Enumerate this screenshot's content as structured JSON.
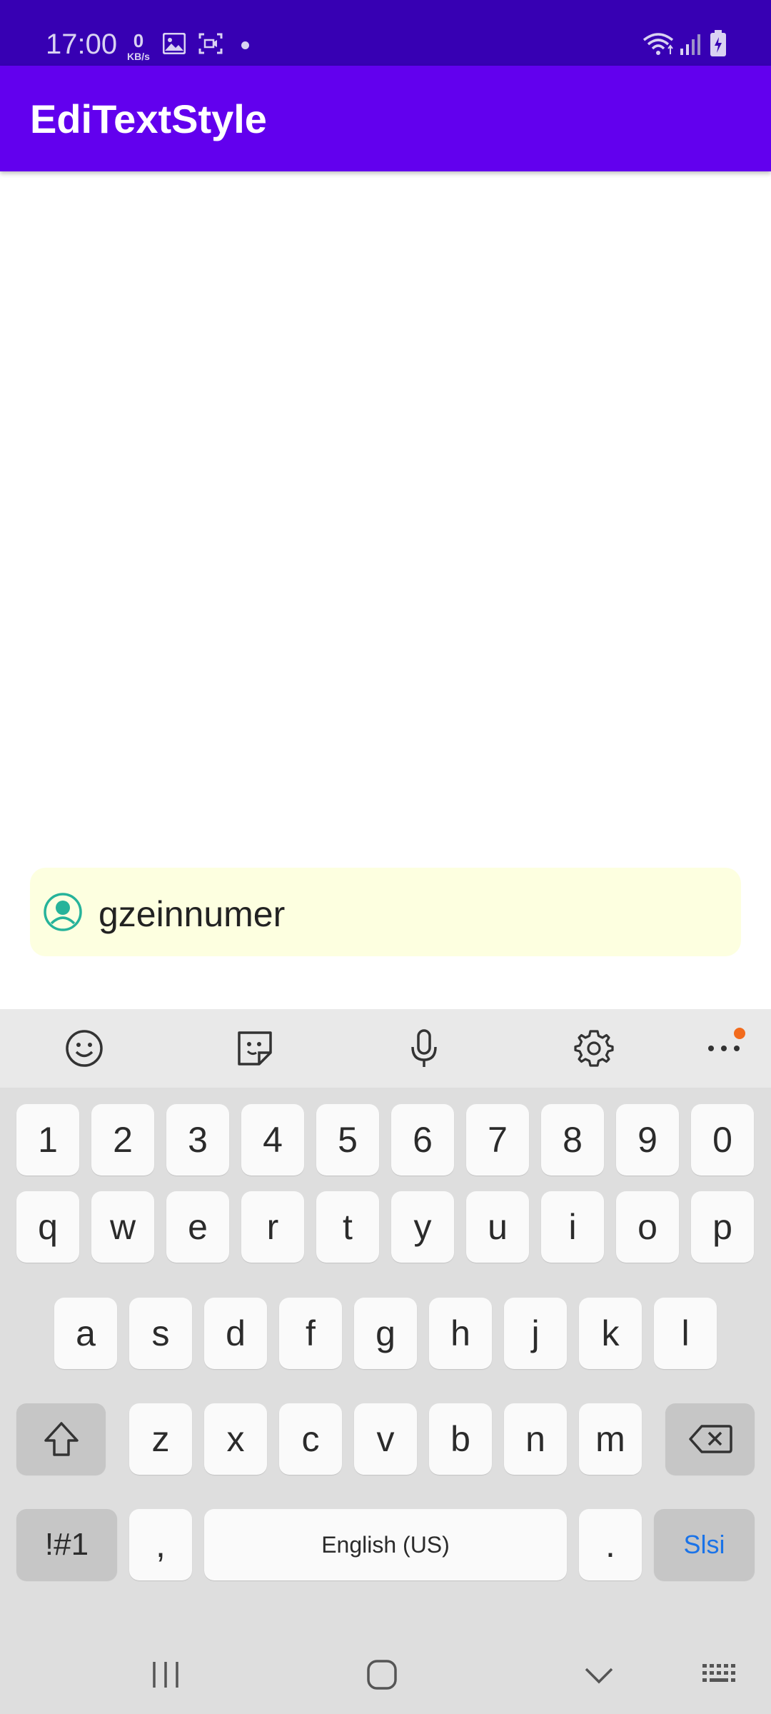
{
  "status_bar": {
    "time": "17:00",
    "net_speed_value": "0",
    "net_speed_unit": "KB/s"
  },
  "app_bar": {
    "title": "EdiTextStyle"
  },
  "text_field": {
    "value": "gzeinnumer"
  },
  "keyboard": {
    "number_row": [
      "1",
      "2",
      "3",
      "4",
      "5",
      "6",
      "7",
      "8",
      "9",
      "0"
    ],
    "row1": [
      "q",
      "w",
      "e",
      "r",
      "t",
      "y",
      "u",
      "i",
      "o",
      "p"
    ],
    "row2": [
      "a",
      "s",
      "d",
      "f",
      "g",
      "h",
      "j",
      "k",
      "l"
    ],
    "row3": [
      "z",
      "x",
      "c",
      "v",
      "b",
      "n",
      "m"
    ],
    "symbols_label": "!#1",
    "comma": ",",
    "space_label": "English (US)",
    "period": ".",
    "action_label": "Slsi"
  },
  "colors": {
    "status_bar": "#3700b3",
    "app_bar": "#6200ee",
    "field_background": "#fdffe0",
    "field_icon": "#26b39a",
    "action_text": "#1a73e8",
    "badge": "#f26b1d"
  }
}
